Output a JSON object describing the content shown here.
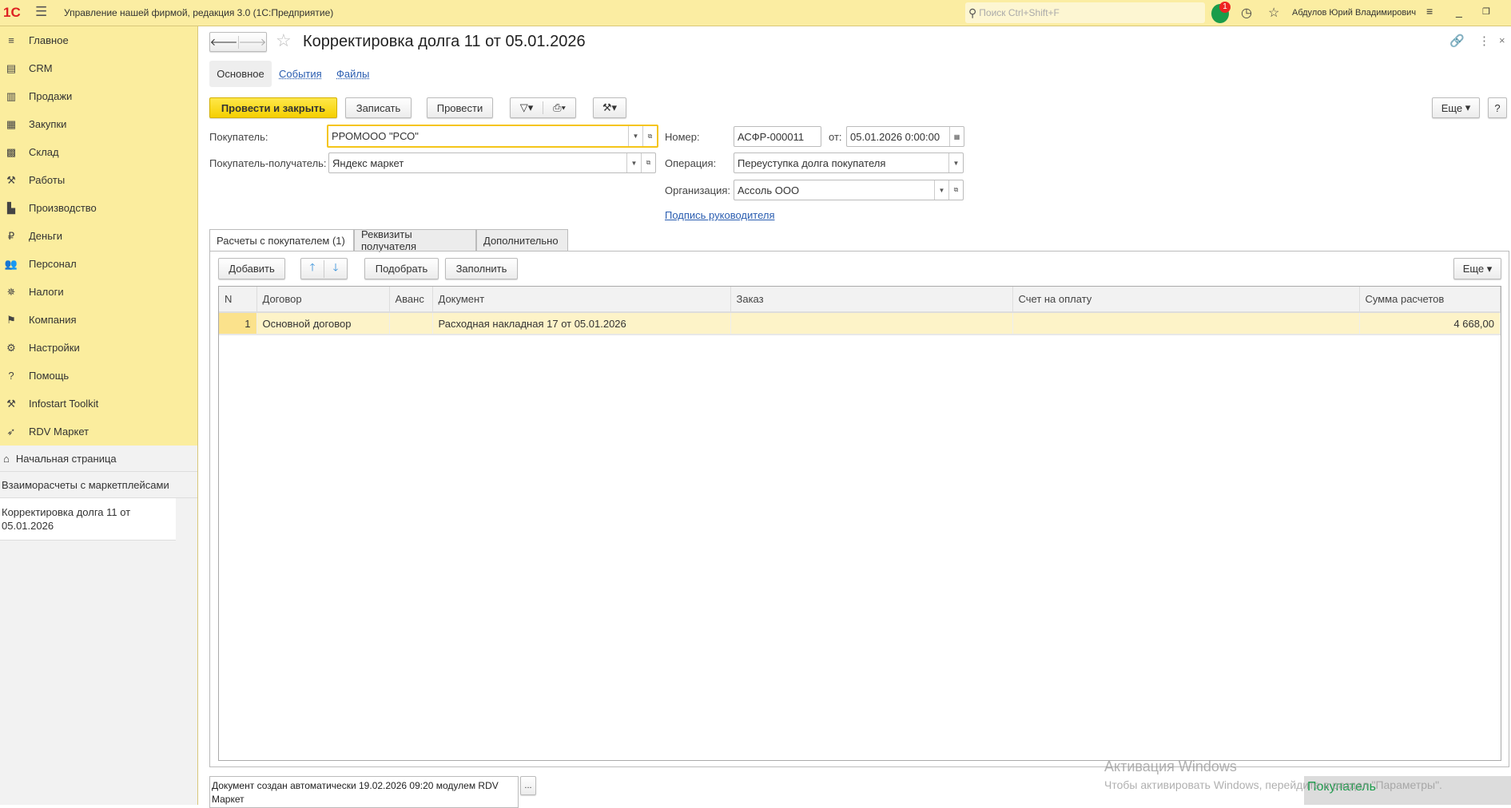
{
  "topbar": {
    "logo": "1С",
    "app_title": "Управление нашей фирмой, редакция 3.0  (1С:Предприятие)",
    "search_placeholder": "Поиск Ctrl+Shift+F",
    "notifications_count": "1",
    "user": "Абдулов Юрий Владимирович"
  },
  "sidebar": {
    "items": [
      {
        "label": "Главное",
        "icon": "menu-icon"
      },
      {
        "label": "CRM",
        "icon": "crm-icon"
      },
      {
        "label": "Продажи",
        "icon": "basket-icon"
      },
      {
        "label": "Закупки",
        "icon": "cart-icon"
      },
      {
        "label": "Склад",
        "icon": "warehouse-icon"
      },
      {
        "label": "Работы",
        "icon": "tools-icon"
      },
      {
        "label": "Производство",
        "icon": "factory-icon"
      },
      {
        "label": "Деньги",
        "icon": "ruble-icon"
      },
      {
        "label": "Персонал",
        "icon": "people-icon"
      },
      {
        "label": "Налоги",
        "icon": "emblem-icon"
      },
      {
        "label": "Компания",
        "icon": "flag-icon"
      },
      {
        "label": "Настройки",
        "icon": "gear-icon"
      },
      {
        "label": "Помощь",
        "icon": "help-icon"
      },
      {
        "label": "Infostart Toolkit",
        "icon": "tools-icon"
      },
      {
        "label": "RDV Маркет",
        "icon": "rocket-icon"
      }
    ],
    "open_windows": [
      "Начальная страница",
      "Взаиморасчеты с маркетплейсами",
      "Корректировка долга 11 от 05.01.2026"
    ]
  },
  "form": {
    "title": "Корректировка долга 11 от 05.01.2026",
    "tabs": [
      "Основное",
      "События",
      "Файлы"
    ],
    "toolbar": {
      "post_close": "Провести и закрыть",
      "save": "Записать",
      "post": "Провести",
      "more": "Еще",
      "help": "?"
    },
    "fields": {
      "buyer_label": "Покупатель:",
      "buyer": "РРОМООО \"РСО\"",
      "recipient_label": "Покупатель-получатель:",
      "recipient": "Яндекс маркет",
      "number_label": "Номер:",
      "number": "АСФР-000011",
      "date_label": "от:",
      "date": "05.01.2026  0:00:00",
      "operation_label": "Операция:",
      "operation": "Переуступка долга покупателя",
      "org_label": "Организация:",
      "org": "Ассоль ООО",
      "signature_link": "Подпись руководителя"
    },
    "page_tabs": [
      "Расчеты с покупателем (1)",
      "Реквизиты получателя",
      "Дополнительно"
    ],
    "table_toolbar": {
      "add": "Добавить",
      "pick": "Подобрать",
      "fill": "Заполнить",
      "more": "Еще"
    },
    "table": {
      "columns": [
        "N",
        "Договор",
        "Аванс",
        "Документ",
        "Заказ",
        "Счет на оплату",
        "Сумма расчетов"
      ],
      "rows": [
        [
          "1",
          "Основной договор",
          "",
          "Расходная накладная 17 от 05.01.2026",
          "",
          "",
          "4 668,00"
        ]
      ]
    },
    "comment": "Документ создан автоматически 19.02.2026 09:20 модулем RDV Маркет",
    "comment_button": "..."
  },
  "side_panel": {
    "title": "Покупатель"
  },
  "watermark": {
    "title": "Активация Windows",
    "text": "Чтобы активировать Windows, перейдите в раздел \"Параметры\"."
  }
}
